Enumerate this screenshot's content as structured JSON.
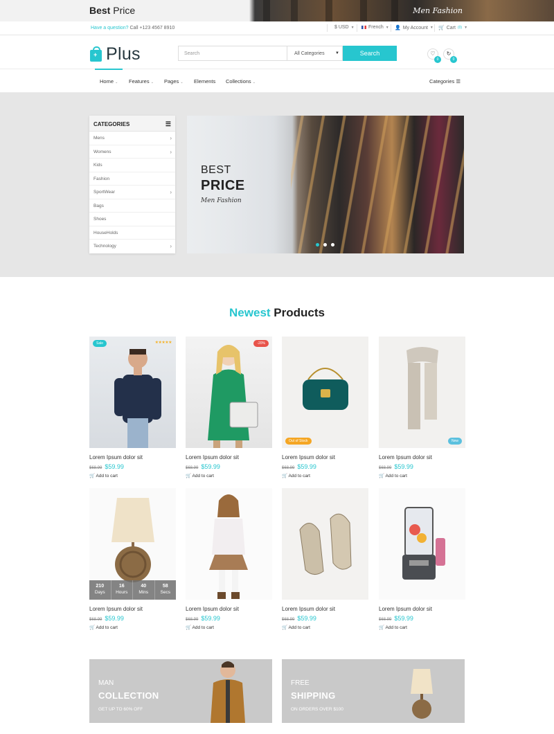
{
  "top_banner": {
    "bold": "Best",
    "rest": " Price",
    "script": "Men Fashion"
  },
  "infobar": {
    "question": "Have a question?",
    "phone": "Call +123 4567 8910",
    "currency": "$ USD",
    "language": "French",
    "account": "My Account",
    "cart": "Cart",
    "cart_count": "(0)"
  },
  "header": {
    "logo_text": "Plus",
    "search_placeholder": "Search",
    "category_select": "All Categories",
    "search_button": "Search",
    "wishlist_count": "0",
    "compare_count": "0"
  },
  "nav": {
    "items": [
      "Home",
      "Features",
      "Pages",
      "Elements",
      "Collections"
    ],
    "right": "Categories"
  },
  "sidebar": {
    "title": "CATEGORIES",
    "items": [
      "Mens",
      "Womens",
      "Kids",
      "Fashion",
      "SportWear",
      "Bags",
      "Shoes",
      "HouseHolds",
      "Technology"
    ]
  },
  "slider": {
    "line1": "BEST",
    "line2": "PRICE",
    "line3": "Men Fashion"
  },
  "section": {
    "title_highlight": "Newest",
    "title_rest": " Products"
  },
  "products": [
    {
      "name": "Lorem Ipsum dolor sit",
      "old": "$68.99",
      "price": "$59.99",
      "add": "Add to cart",
      "badge": "Sale",
      "badge_color": "#27c6cf"
    },
    {
      "name": "Lorem Ipsum dolor sit",
      "old": "$68.99",
      "price": "$59.99",
      "add": "Add to cart",
      "badge": "-20%",
      "badge_color": "#e8534a"
    },
    {
      "name": "Lorem Ipsum dolor sit",
      "old": "$68.99",
      "price": "$59.99",
      "add": "Add to cart",
      "badge": "Out of Stock",
      "badge_color": "#f5a623"
    },
    {
      "name": "Lorem Ipsum dolor sit",
      "old": "$68.99",
      "price": "$59.99",
      "add": "Add to cart",
      "badge": "New",
      "badge_color": "#5bc0de"
    },
    {
      "name": "Lorem Ipsum dolor sit",
      "old": "$68.99",
      "price": "$59.99",
      "add": "Add to cart"
    },
    {
      "name": "Lorem Ipsum dolor sit",
      "old": "$68.99",
      "price": "$59.99",
      "add": "Add to cart"
    },
    {
      "name": "Lorem Ipsum dolor sit",
      "old": "$68.99",
      "price": "$59.99",
      "add": "Add to cart"
    },
    {
      "name": "Lorem Ipsum dolor sit",
      "old": "$68.99",
      "price": "$59.99",
      "add": "Add to cart"
    }
  ],
  "countdown": [
    {
      "value": "210",
      "unit": "Days"
    },
    {
      "value": "16",
      "unit": "Hours"
    },
    {
      "value": "40",
      "unit": "Mins"
    },
    {
      "value": "58",
      "unit": "Secs"
    }
  ],
  "promos": [
    {
      "l1": "MAN",
      "l2": "COLLECTION",
      "l3": "GET UP TO 60% OFF"
    },
    {
      "l1": "FREE",
      "l2": "SHIPPING",
      "l3": "ON ORDERS OVER $100"
    }
  ],
  "colors": {
    "accent": "#27c6cf",
    "sale": "#27c6cf",
    "discount": "#e8534a",
    "out_of_stock": "#f5a623",
    "new": "#5bc0de"
  }
}
